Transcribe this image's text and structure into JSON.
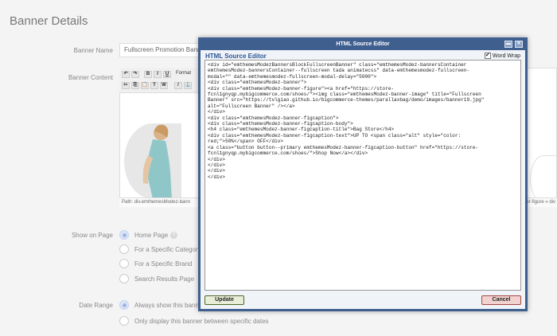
{
  "page": {
    "title": "Banner Details"
  },
  "form": {
    "banner_name_label": "Banner Name",
    "banner_name_value": "Fullscreen Promotion Banner",
    "banner_content_label": "Banner Content",
    "toolbar": {
      "bold": "B",
      "italic": "I",
      "underline": "U",
      "format": "Format"
    },
    "path_text": "Path: div.emthemesModez-bann",
    "path_right_text": "nner-figure » div",
    "show_on_page_label": "Show on Page",
    "show_options": [
      {
        "label": "Home Page",
        "selected": true
      },
      {
        "label": "For a Specific Category",
        "selected": false
      },
      {
        "label": "For a Specific Brand",
        "selected": false
      },
      {
        "label": "Search Results Page",
        "selected": false
      }
    ],
    "date_range_label": "Date Range",
    "date_options": [
      {
        "label": "Always show this banner",
        "selected": true
      },
      {
        "label": "Only display this banner between specific dates",
        "selected": false
      }
    ]
  },
  "dialog": {
    "window_title": "HTML Source Editor",
    "editor_title": "HTML Source Editor",
    "word_wrap_label": "Word Wrap",
    "word_wrap_checked": true,
    "source": "<div id=\"emthemesModezBannersBlockFullscreenBanner\" class=\"emthemesModez-bannersContainer\nemthemesModez-bannersContainer--fullscreen tada animatecss\" data-emthemesmodez-fullscreen-\nmodal=\"\" data-emthemesmodez-fullscreen-modal-delay=\"5000\">\n<div class=\"emthemesModez-banner\">\n<div class=\"emthemesModez-banner-figure\"><a href=\"https://store-\nfcnl1gnyqp.mybigcommerce.com/shoes/\"><img class=\"emthemesModez-banner-image\" title=\"Fullscreen\nBanner\" src=\"https://tvlgiao.github.io/bigcommerce-themes/parallaxbag/demo/images/banner19.jpg\"\nalt=\"Fullscreen Banner\" /></a>\n</div>\n<div class=\"emthemesModez-banner-figcaption\">\n<div class=\"emthemesModez-banner-figcaption-body\">\n<h4 class=\"emthemesModez-banner-figcaption-title\">Bag Store</h4>\n<div class=\"emthemesModez-banner-figcaption-text\">UP TO <span class=\"alt\" style=\"color:\nred;\">50%</span> OFF</div>\n<a class=\"button button--primary emthemesModez-banner-figcaption-button\" href=\"https://store-\nfcnl1gnyqp.mybigcommerce.com/shoes/\">Shop Now</a></div>\n</div>\n</div>\n</div>\n</div>",
    "update_label": "Update",
    "cancel_label": "Cancel",
    "minimize_glyph": "▬",
    "close_glyph": "✕"
  },
  "colors": {
    "dialog_frame": "#3f5f8f",
    "editor_title": "#2b5599",
    "update_border": "#50682a",
    "cancel_border": "#a54b47"
  }
}
